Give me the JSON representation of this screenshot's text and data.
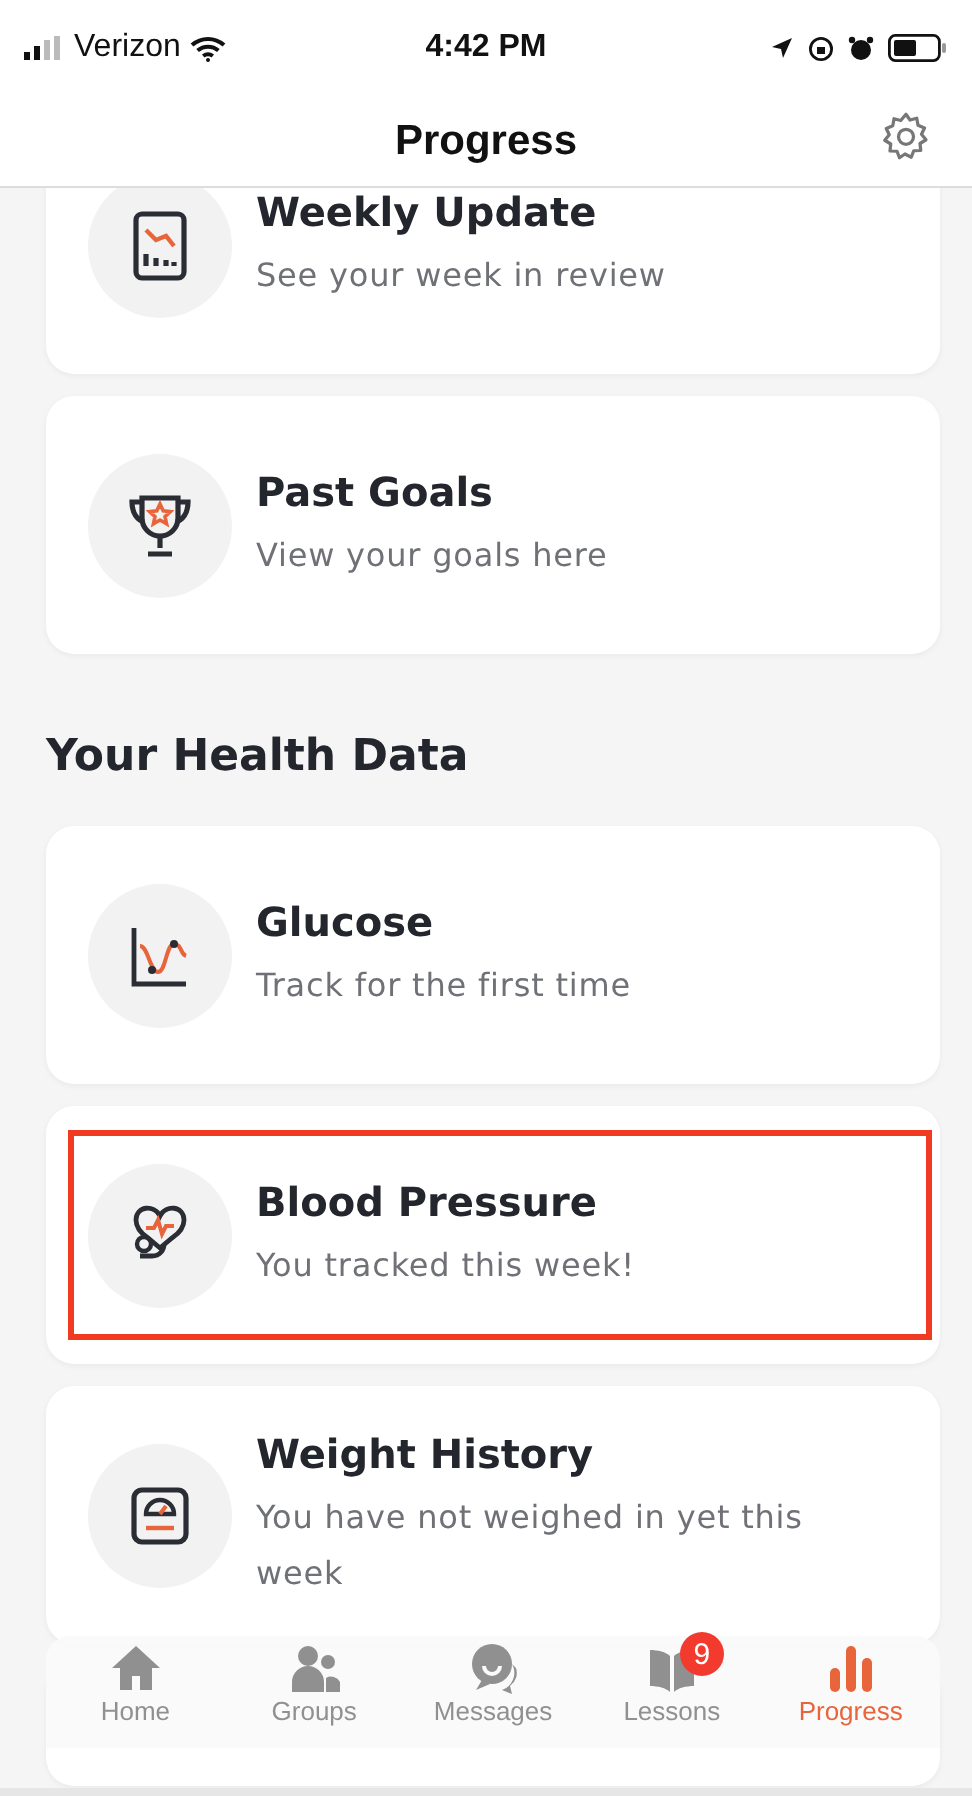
{
  "status_bar": {
    "carrier": "Verizon",
    "time": "4:42 PM"
  },
  "header": {
    "title": "Progress"
  },
  "top_cards": [
    {
      "title": "Weekly Update",
      "subtitle": "See your week in review",
      "highlighted": false
    },
    {
      "title": "Past Goals",
      "subtitle": "View your goals here",
      "highlighted": false
    }
  ],
  "section_title": "Your Health Data",
  "health_cards": [
    {
      "title": "Glucose",
      "subtitle": "Track for the first time",
      "highlighted": false
    },
    {
      "title": "Blood Pressure",
      "subtitle": "You tracked this week!",
      "highlighted": true
    },
    {
      "title": "Weight History",
      "subtitle": "You have not weighed in yet this week",
      "highlighted": false
    }
  ],
  "tab_bar": [
    {
      "label": "Home",
      "selected": false
    },
    {
      "label": "Groups",
      "selected": false
    },
    {
      "label": "Messages",
      "selected": false
    },
    {
      "label": "Lessons",
      "selected": false,
      "badge": "9"
    },
    {
      "label": "Progress",
      "selected": true
    }
  ]
}
